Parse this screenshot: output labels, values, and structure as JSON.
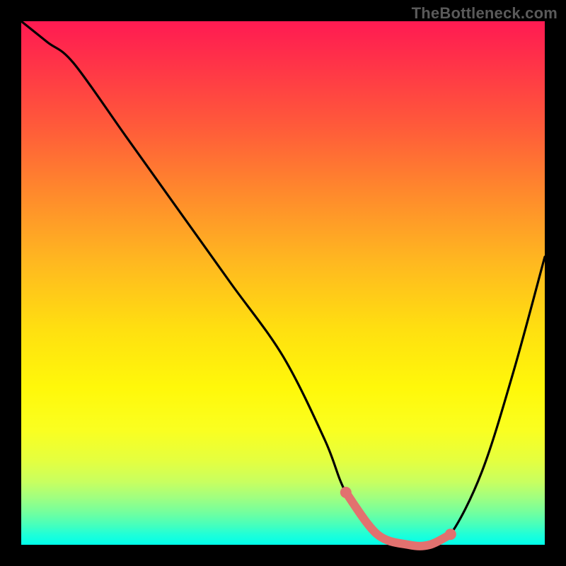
{
  "watermark": "TheBottleneck.com",
  "chart_data": {
    "type": "line",
    "title": "",
    "xlabel": "",
    "ylabel": "",
    "xlim": [
      0,
      100
    ],
    "ylim": [
      0,
      100
    ],
    "series": [
      {
        "name": "bottleneck-curve",
        "color": "#000000",
        "x": [
          0,
          5,
          10,
          20,
          30,
          40,
          50,
          58,
          62,
          68,
          74,
          78,
          82,
          88,
          94,
          100
        ],
        "y": [
          100,
          96,
          92,
          78,
          64,
          50,
          36,
          20,
          10,
          2,
          0,
          0,
          2,
          14,
          33,
          55
        ]
      }
    ],
    "highlight": {
      "name": "optimal-range",
      "color": "#e2716f",
      "x": [
        62,
        68,
        74,
        78,
        82
      ],
      "y": [
        10,
        2,
        0,
        0,
        2
      ]
    },
    "grid": false,
    "legend": false
  }
}
